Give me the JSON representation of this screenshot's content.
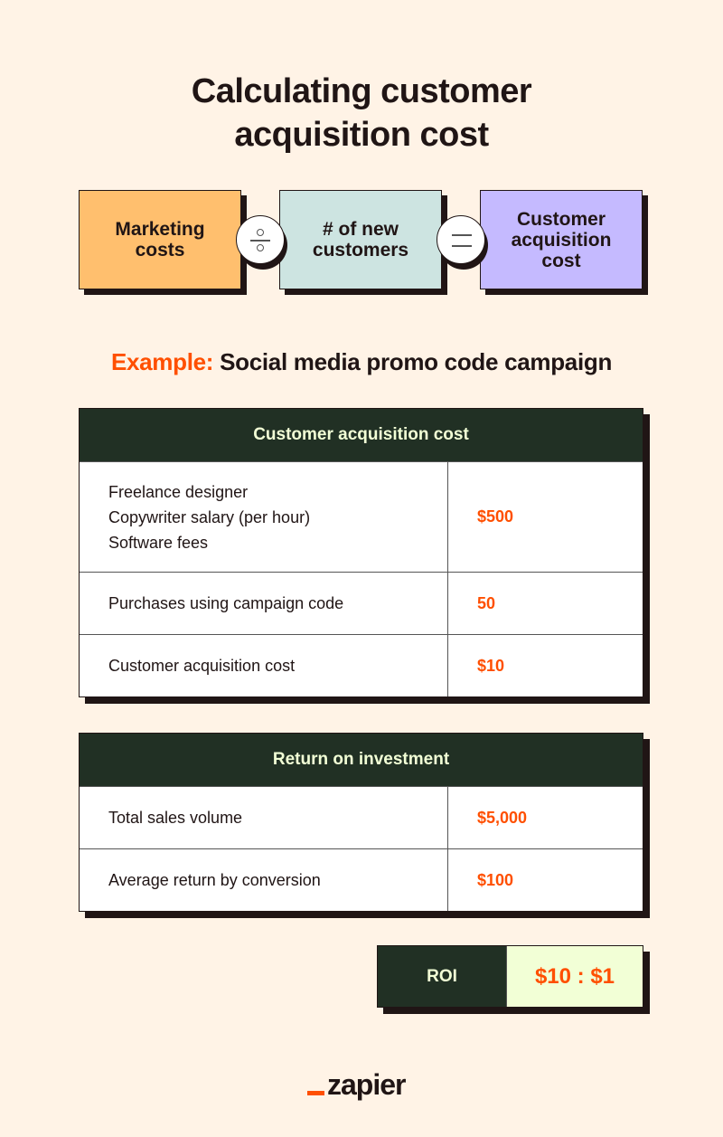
{
  "title": {
    "line1": "Calculating customer",
    "line2": "acquisition cost"
  },
  "formula": {
    "term1": {
      "line1": "Marketing",
      "line2": "costs",
      "color": "#ffbf6e"
    },
    "operator1": "divide-icon",
    "term2": {
      "line1": "# of new",
      "line2": "customers",
      "color": "#cde4e1"
    },
    "operator2": "equals-icon",
    "result": {
      "line1": "Customer",
      "line2": "acquisition",
      "line3": "cost",
      "color": "#c5baff"
    }
  },
  "example": {
    "label": "Example:",
    "text": "Social media promo code campaign"
  },
  "cac_table": {
    "header": "Customer acquisition cost",
    "rows": [
      {
        "labels": [
          "Freelance designer",
          "Copywriter salary (per hour)",
          "Software fees"
        ],
        "value": "$500"
      },
      {
        "labels": [
          "Purchases using campaign code"
        ],
        "value": "50"
      },
      {
        "labels": [
          "Customer acquisition cost"
        ],
        "value": "$10"
      }
    ]
  },
  "roi_table": {
    "header": "Return on investment",
    "rows": [
      {
        "labels": [
          "Total sales volume"
        ],
        "value": "$5,000"
      },
      {
        "labels": [
          "Average return by conversion"
        ],
        "value": "$100"
      }
    ]
  },
  "roi": {
    "label": "ROI",
    "value": "$10 : $1"
  },
  "brand": {
    "name": "zapier",
    "accent": "#ff4f00"
  },
  "colors": {
    "background": "#fff3e6",
    "dark_green": "#213024",
    "light_green": "#f2ffd6",
    "orange": "#ff4f00",
    "ink": "#201515"
  }
}
